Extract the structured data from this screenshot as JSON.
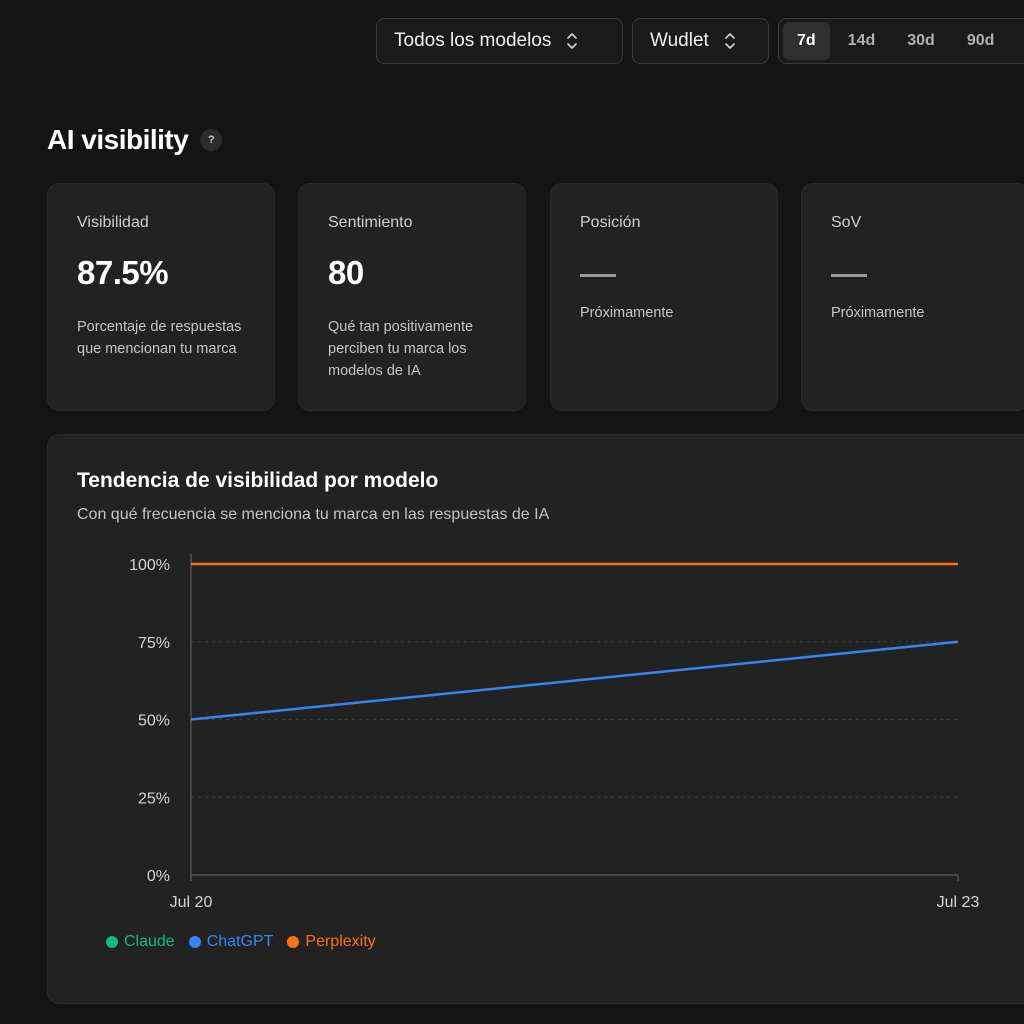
{
  "toolbar": {
    "model_select": "Todos los modelos",
    "brand_select": "Wudlet",
    "periods": [
      "7d",
      "14d",
      "30d",
      "90d"
    ],
    "active_period": "7d"
  },
  "header": {
    "title": "AI visibility",
    "help_label": "?"
  },
  "metrics": [
    {
      "label": "Visibilidad",
      "value": "87.5%",
      "description": "Porcentaje de respuestas que mencionan tu marca"
    },
    {
      "label": "Sentimiento",
      "value": "80",
      "description": "Qué tan positivamente perciben tu marca los modelos de IA"
    },
    {
      "label": "Posición",
      "value": "—",
      "description": "Próximamente"
    },
    {
      "label": "SoV",
      "value": "—",
      "description": "Próximamente"
    }
  ],
  "trend": {
    "title": "Tendencia de visibilidad por modelo",
    "subtitle": "Con qué frecuencia se menciona tu marca en las respuestas de IA"
  },
  "colors": {
    "claude": "#10b981",
    "chatgpt": "#3b82f6",
    "perplexity": "#f97316",
    "axis": "#6b6b6b",
    "grid": "#3a3a3a"
  },
  "chart_data": {
    "type": "line",
    "x": [
      "Jul 20",
      "Jul 23"
    ],
    "y_ticks": [
      "0%",
      "25%",
      "50%",
      "75%",
      "100%"
    ],
    "ylim": [
      0,
      100
    ],
    "grid": true,
    "legend": "bottom-left",
    "series": [
      {
        "name": "Claude",
        "values": [
          null,
          null
        ]
      },
      {
        "name": "ChatGPT",
        "values": [
          50,
          75
        ]
      },
      {
        "name": "Perplexity",
        "values": [
          100,
          100
        ]
      }
    ]
  }
}
